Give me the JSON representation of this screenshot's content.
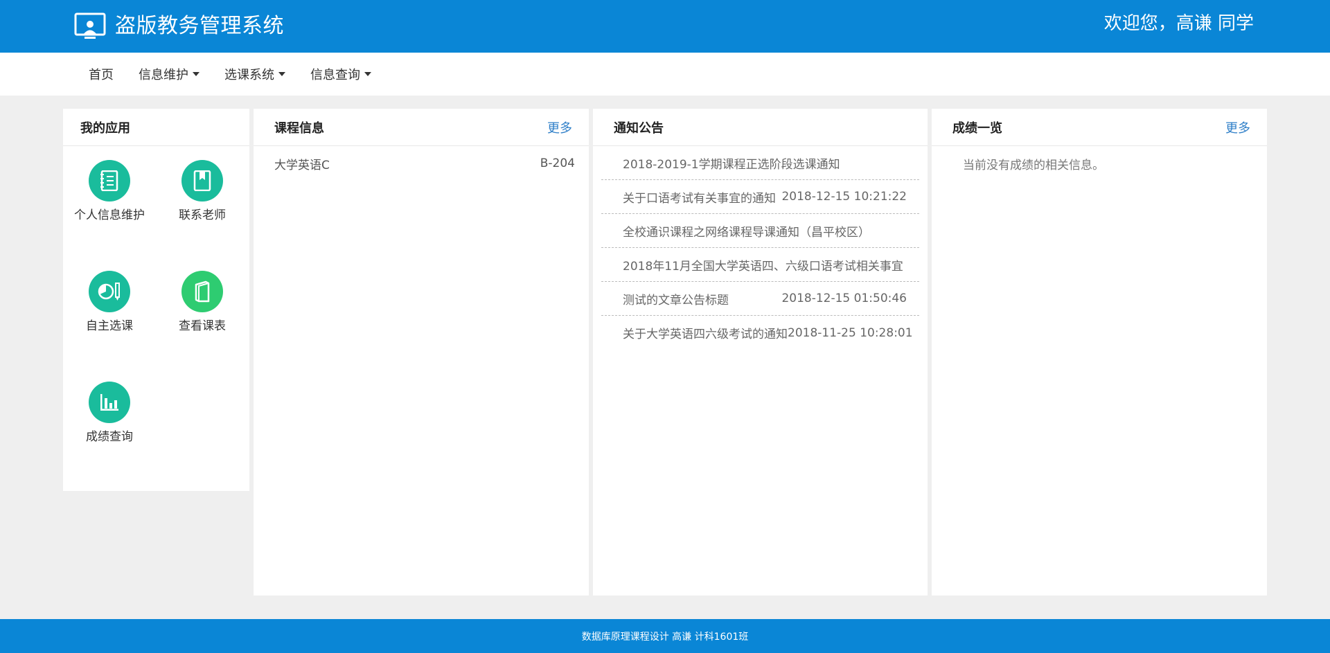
{
  "header": {
    "app_title": "盗版教务管理系统",
    "welcome": "欢迎您，高谦 同学",
    "logo_icon": "monitor-user-icon"
  },
  "nav": {
    "items": [
      {
        "label": "首页",
        "dropdown": false
      },
      {
        "label": "信息维护",
        "dropdown": true
      },
      {
        "label": "选课系统",
        "dropdown": true
      },
      {
        "label": "信息查询",
        "dropdown": true
      }
    ]
  },
  "apps": {
    "title": "我的应用",
    "items": [
      {
        "label": "个人信息维护",
        "icon": "document-icon",
        "color": "#1abc9c"
      },
      {
        "label": "联系老师",
        "icon": "bookmark-book-icon",
        "color": "#1abc9c"
      },
      {
        "label": "自主选课",
        "icon": "pie-pencil-icon",
        "color": "#1abc9c"
      },
      {
        "label": "查看课表",
        "icon": "notebook-icon",
        "color": "#2ecc71"
      },
      {
        "label": "成绩查询",
        "icon": "bar-chart-icon",
        "color": "#1abc9c"
      }
    ]
  },
  "course": {
    "title": "课程信息",
    "more": "更多",
    "rows": [
      {
        "name": "大学英语C",
        "room": "B-204"
      }
    ]
  },
  "notice": {
    "title": "通知公告",
    "rows": [
      {
        "title": "2018-2019-1学期课程正选阶段选课通知",
        "date": ""
      },
      {
        "title": "关于口语考试有关事宜的通知",
        "date": "2018-12-15 10:21:22"
      },
      {
        "title": "全校通识课程之网络课程导课通知（昌平校区）",
        "date": ""
      },
      {
        "title": "2018年11月全国大学英语四、六级口语考试相关事宜",
        "date": ""
      },
      {
        "title": "测试的文章公告标题",
        "date": "2018-12-15 01:50:46"
      },
      {
        "title": "关于大学英语四六级考试的通知",
        "date": "2018-11-25 10:28:01"
      }
    ]
  },
  "score": {
    "title": "成绩一览",
    "more": "更多",
    "empty": "当前没有成绩的相关信息。"
  },
  "footer": {
    "text": "数据库原理课程设计 高谦 计科1601班"
  },
  "colors": {
    "brand": "#0a86d6",
    "link": "#2f7fc8",
    "teal": "#1abc9c",
    "green": "#2ecc71"
  }
}
